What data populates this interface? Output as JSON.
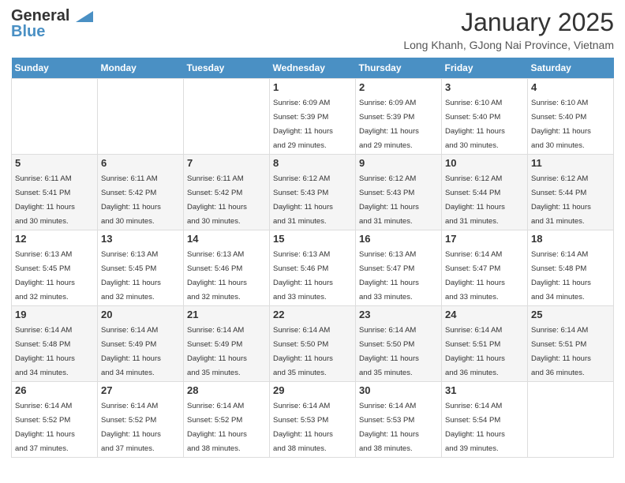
{
  "header": {
    "logo_line1": "General",
    "logo_line2": "Blue",
    "month": "January 2025",
    "location": "Long Khanh, GJong Nai Province, Vietnam"
  },
  "days": [
    "Sunday",
    "Monday",
    "Tuesday",
    "Wednesday",
    "Thursday",
    "Friday",
    "Saturday"
  ],
  "weeks": [
    [
      {
        "day": "",
        "info": ""
      },
      {
        "day": "",
        "info": ""
      },
      {
        "day": "",
        "info": ""
      },
      {
        "day": "1",
        "info": "Sunrise: 6:09 AM\nSunset: 5:39 PM\nDaylight: 11 hours\nand 29 minutes."
      },
      {
        "day": "2",
        "info": "Sunrise: 6:09 AM\nSunset: 5:39 PM\nDaylight: 11 hours\nand 29 minutes."
      },
      {
        "day": "3",
        "info": "Sunrise: 6:10 AM\nSunset: 5:40 PM\nDaylight: 11 hours\nand 30 minutes."
      },
      {
        "day": "4",
        "info": "Sunrise: 6:10 AM\nSunset: 5:40 PM\nDaylight: 11 hours\nand 30 minutes."
      }
    ],
    [
      {
        "day": "5",
        "info": "Sunrise: 6:11 AM\nSunset: 5:41 PM\nDaylight: 11 hours\nand 30 minutes."
      },
      {
        "day": "6",
        "info": "Sunrise: 6:11 AM\nSunset: 5:42 PM\nDaylight: 11 hours\nand 30 minutes."
      },
      {
        "day": "7",
        "info": "Sunrise: 6:11 AM\nSunset: 5:42 PM\nDaylight: 11 hours\nand 30 minutes."
      },
      {
        "day": "8",
        "info": "Sunrise: 6:12 AM\nSunset: 5:43 PM\nDaylight: 11 hours\nand 31 minutes."
      },
      {
        "day": "9",
        "info": "Sunrise: 6:12 AM\nSunset: 5:43 PM\nDaylight: 11 hours\nand 31 minutes."
      },
      {
        "day": "10",
        "info": "Sunrise: 6:12 AM\nSunset: 5:44 PM\nDaylight: 11 hours\nand 31 minutes."
      },
      {
        "day": "11",
        "info": "Sunrise: 6:12 AM\nSunset: 5:44 PM\nDaylight: 11 hours\nand 31 minutes."
      }
    ],
    [
      {
        "day": "12",
        "info": "Sunrise: 6:13 AM\nSunset: 5:45 PM\nDaylight: 11 hours\nand 32 minutes."
      },
      {
        "day": "13",
        "info": "Sunrise: 6:13 AM\nSunset: 5:45 PM\nDaylight: 11 hours\nand 32 minutes."
      },
      {
        "day": "14",
        "info": "Sunrise: 6:13 AM\nSunset: 5:46 PM\nDaylight: 11 hours\nand 32 minutes."
      },
      {
        "day": "15",
        "info": "Sunrise: 6:13 AM\nSunset: 5:46 PM\nDaylight: 11 hours\nand 33 minutes."
      },
      {
        "day": "16",
        "info": "Sunrise: 6:13 AM\nSunset: 5:47 PM\nDaylight: 11 hours\nand 33 minutes."
      },
      {
        "day": "17",
        "info": "Sunrise: 6:14 AM\nSunset: 5:47 PM\nDaylight: 11 hours\nand 33 minutes."
      },
      {
        "day": "18",
        "info": "Sunrise: 6:14 AM\nSunset: 5:48 PM\nDaylight: 11 hours\nand 34 minutes."
      }
    ],
    [
      {
        "day": "19",
        "info": "Sunrise: 6:14 AM\nSunset: 5:48 PM\nDaylight: 11 hours\nand 34 minutes."
      },
      {
        "day": "20",
        "info": "Sunrise: 6:14 AM\nSunset: 5:49 PM\nDaylight: 11 hours\nand 34 minutes."
      },
      {
        "day": "21",
        "info": "Sunrise: 6:14 AM\nSunset: 5:49 PM\nDaylight: 11 hours\nand 35 minutes."
      },
      {
        "day": "22",
        "info": "Sunrise: 6:14 AM\nSunset: 5:50 PM\nDaylight: 11 hours\nand 35 minutes."
      },
      {
        "day": "23",
        "info": "Sunrise: 6:14 AM\nSunset: 5:50 PM\nDaylight: 11 hours\nand 35 minutes."
      },
      {
        "day": "24",
        "info": "Sunrise: 6:14 AM\nSunset: 5:51 PM\nDaylight: 11 hours\nand 36 minutes."
      },
      {
        "day": "25",
        "info": "Sunrise: 6:14 AM\nSunset: 5:51 PM\nDaylight: 11 hours\nand 36 minutes."
      }
    ],
    [
      {
        "day": "26",
        "info": "Sunrise: 6:14 AM\nSunset: 5:52 PM\nDaylight: 11 hours\nand 37 minutes."
      },
      {
        "day": "27",
        "info": "Sunrise: 6:14 AM\nSunset: 5:52 PM\nDaylight: 11 hours\nand 37 minutes."
      },
      {
        "day": "28",
        "info": "Sunrise: 6:14 AM\nSunset: 5:52 PM\nDaylight: 11 hours\nand 38 minutes."
      },
      {
        "day": "29",
        "info": "Sunrise: 6:14 AM\nSunset: 5:53 PM\nDaylight: 11 hours\nand 38 minutes."
      },
      {
        "day": "30",
        "info": "Sunrise: 6:14 AM\nSunset: 5:53 PM\nDaylight: 11 hours\nand 38 minutes."
      },
      {
        "day": "31",
        "info": "Sunrise: 6:14 AM\nSunset: 5:54 PM\nDaylight: 11 hours\nand 39 minutes."
      },
      {
        "day": "",
        "info": ""
      }
    ]
  ]
}
